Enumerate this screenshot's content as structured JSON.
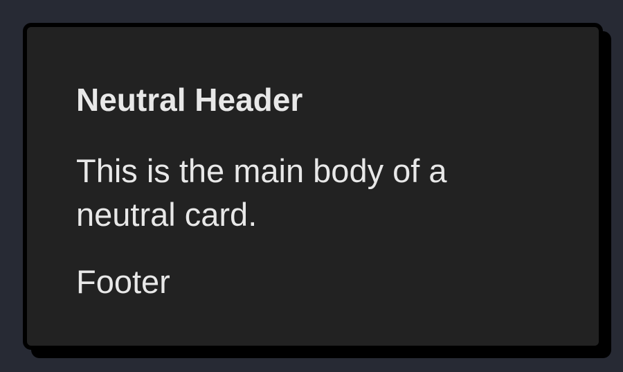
{
  "card": {
    "header": "Neutral Header",
    "body": "This is the main body of a neutral card.",
    "footer": "Footer"
  },
  "colors": {
    "page_background": "#272a34",
    "card_background": "#222222",
    "card_border": "#000000",
    "text": "#e8e8e8"
  }
}
